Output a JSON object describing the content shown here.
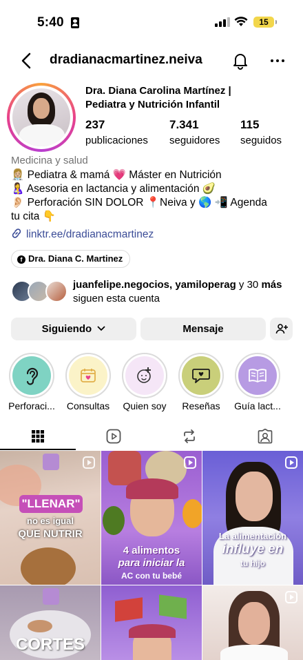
{
  "status_bar": {
    "time": "5:40",
    "battery": "15"
  },
  "header": {
    "username": "dradianacmartinez.neiva"
  },
  "profile": {
    "name_line1": "Dra. Diana Carolina Martínez |",
    "name_line2": "Pediatra y Nutrición Infantil",
    "stats": {
      "posts": {
        "value": "237",
        "label": "publicaciones"
      },
      "followers": {
        "value": "7.341",
        "label": "seguidores"
      },
      "following": {
        "value": "115",
        "label": "seguidos"
      }
    },
    "category": "Medicina y salud",
    "bio": [
      "👩🏼‍⚕️ Pediatra & mamá 💗 Máster en Nutrición",
      "🤱 Asesoria en lactancia y alimentación 🥑",
      "👂🏻 Perforación SIN DOLOR 📍Neiva y 🌎 📲 Agenda",
      "tu cita 👇"
    ],
    "link": "linktr.ee/dradianacmartinez",
    "facebook": "Dra. Diana C. Martinez",
    "followed_by": {
      "users": "juanfelipe.negocios, yamiloperag",
      "connector": " y 30",
      "more": "más",
      "suffix": " siguen esta cuenta"
    }
  },
  "actions": {
    "following": "Siguiendo",
    "message": "Mensaje"
  },
  "highlights": [
    {
      "label": "Perforaci...",
      "icon": "ear-icon",
      "color": "#7fd3c3"
    },
    {
      "label": "Consultas",
      "icon": "calendar-icon",
      "color": "#fbf3c8"
    },
    {
      "label": "Quien soy",
      "icon": "baby-icon",
      "color": "#f5e6f7"
    },
    {
      "label": "Reseñas",
      "icon": "chat-heart-icon",
      "color": "#c9cf7a"
    },
    {
      "label": "Guía lact...",
      "icon": "book-icon",
      "color": "#b79be3"
    }
  ],
  "posts": [
    {
      "line1": "\"LLENAR\"",
      "line2": "no es igual",
      "line3": "QUE NUTRIR"
    },
    {
      "line1": "4 alimentos",
      "line2": "para iniciar la",
      "line3": "AC con tu bebé"
    },
    {
      "line1": "La alimentación",
      "line2": "influye en",
      "line3": "tu hijo"
    },
    {
      "line1": "CORTES",
      "line2": "",
      "line3": ""
    }
  ]
}
